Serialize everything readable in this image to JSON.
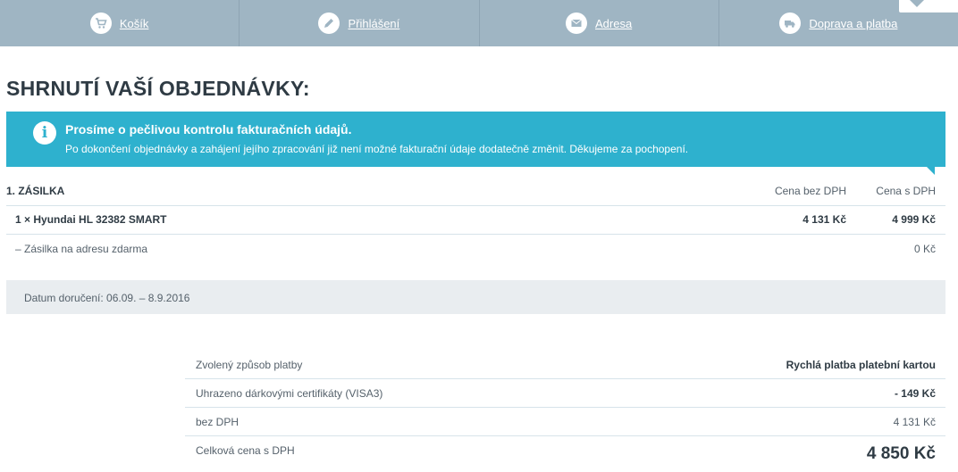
{
  "steps": [
    {
      "label": "Košík",
      "icon": "cart-icon"
    },
    {
      "label": "Přihlášení",
      "icon": "pencil-icon"
    },
    {
      "label": "Adresa",
      "icon": "envelope-icon"
    },
    {
      "label": "Doprava a platba",
      "icon": "truck-icon"
    }
  ],
  "page": {
    "title": "SHRNUTÍ VAŠÍ OBJEDNÁVKY:"
  },
  "info": {
    "title": "Prosíme o pečlivou kontrolu fakturačních údajů.",
    "text": "Po dokončení objednávky a zahájení jejího zpracování již není možné fakturační údaje dodatečně změnit. Děkujeme za pochopení."
  },
  "shipment": {
    "title": "1. ZÁSILKA",
    "col_without_vat": "Cena bez DPH",
    "col_with_vat": "Cena s DPH",
    "item": {
      "name": "1 × Hyundai HL 32382 SMART",
      "price_without_vat": "4 131 Kč",
      "price_with_vat": "4 999 Kč"
    },
    "shipping": {
      "name": "– Zásilka na adresu zdarma",
      "price": "0 Kč"
    },
    "delivery": "Datum doručení: 06.09. – 8.9.2016"
  },
  "summary": {
    "payment_label": "Zvolený způsob platby",
    "payment_value": "Rychlá platba platební kartou",
    "voucher_label": "Uhrazeno dárkovými certifikáty (VISA3)",
    "voucher_value": "- 149 Kč",
    "net_label": "bez DPH",
    "net_value": "4 131 Kč",
    "total_label": "Celková cena s DPH",
    "total_value": "4 850 Kč"
  },
  "colors": {
    "steps_bar": "#9fb5c3",
    "info_box": "#2eb1ce",
    "delivery_bg": "#e9edf0"
  }
}
